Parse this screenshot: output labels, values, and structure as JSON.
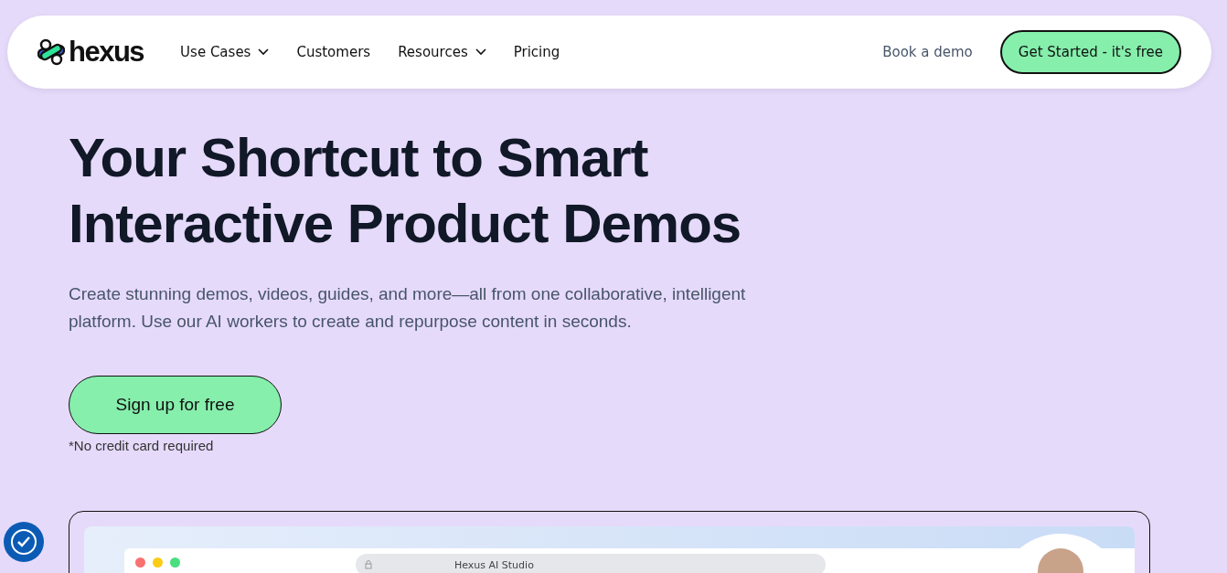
{
  "nav": {
    "logo": "hexus",
    "items": [
      {
        "label": "Use Cases",
        "dropdown": true
      },
      {
        "label": "Customers",
        "dropdown": false
      },
      {
        "label": "Resources",
        "dropdown": true
      },
      {
        "label": "Pricing",
        "dropdown": false
      }
    ],
    "book_demo": "Book a demo",
    "cta": "Get Started - it's free"
  },
  "hero": {
    "title_lines": [
      "Your Shortcut to Smart",
      "Interactive Product Demos"
    ],
    "subtitle": "Create stunning demos, videos, guides, and more—all from one collaborative, intelligent platform. Use our AI workers to create and repurpose content in seconds.",
    "button": "Sign up for free",
    "note": "*No credit card required"
  },
  "preview": {
    "address": "Hexus AI Studio"
  }
}
